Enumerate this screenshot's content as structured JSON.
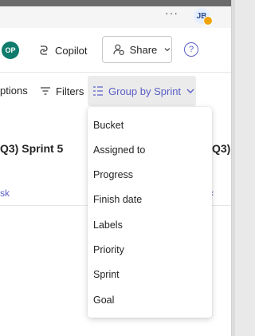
{
  "topbar": {
    "more_glyph": "···",
    "user_initials": "JB"
  },
  "header": {
    "member_initials": "OP",
    "copilot_label": "Copilot",
    "share_label": "Share",
    "help_glyph": "?"
  },
  "toolbar": {
    "options_label": "ptions",
    "filters_label": "Filters",
    "group_by_label": "Group by Sprint"
  },
  "board": {
    "left_column_title": "Q3) Sprint 5",
    "right_column_title": "Q3)",
    "left_add_task": "sk",
    "right_chevron": "‹"
  },
  "group_by_menu": {
    "items": [
      "Bucket",
      "Assigned to",
      "Progress",
      "Finish date",
      "Labels",
      "Priority",
      "Sprint",
      "Goal"
    ]
  },
  "colors": {
    "accent": "#5b5fc7",
    "member_avatar": "#0f7b6c",
    "badge": "#f0a30a"
  }
}
